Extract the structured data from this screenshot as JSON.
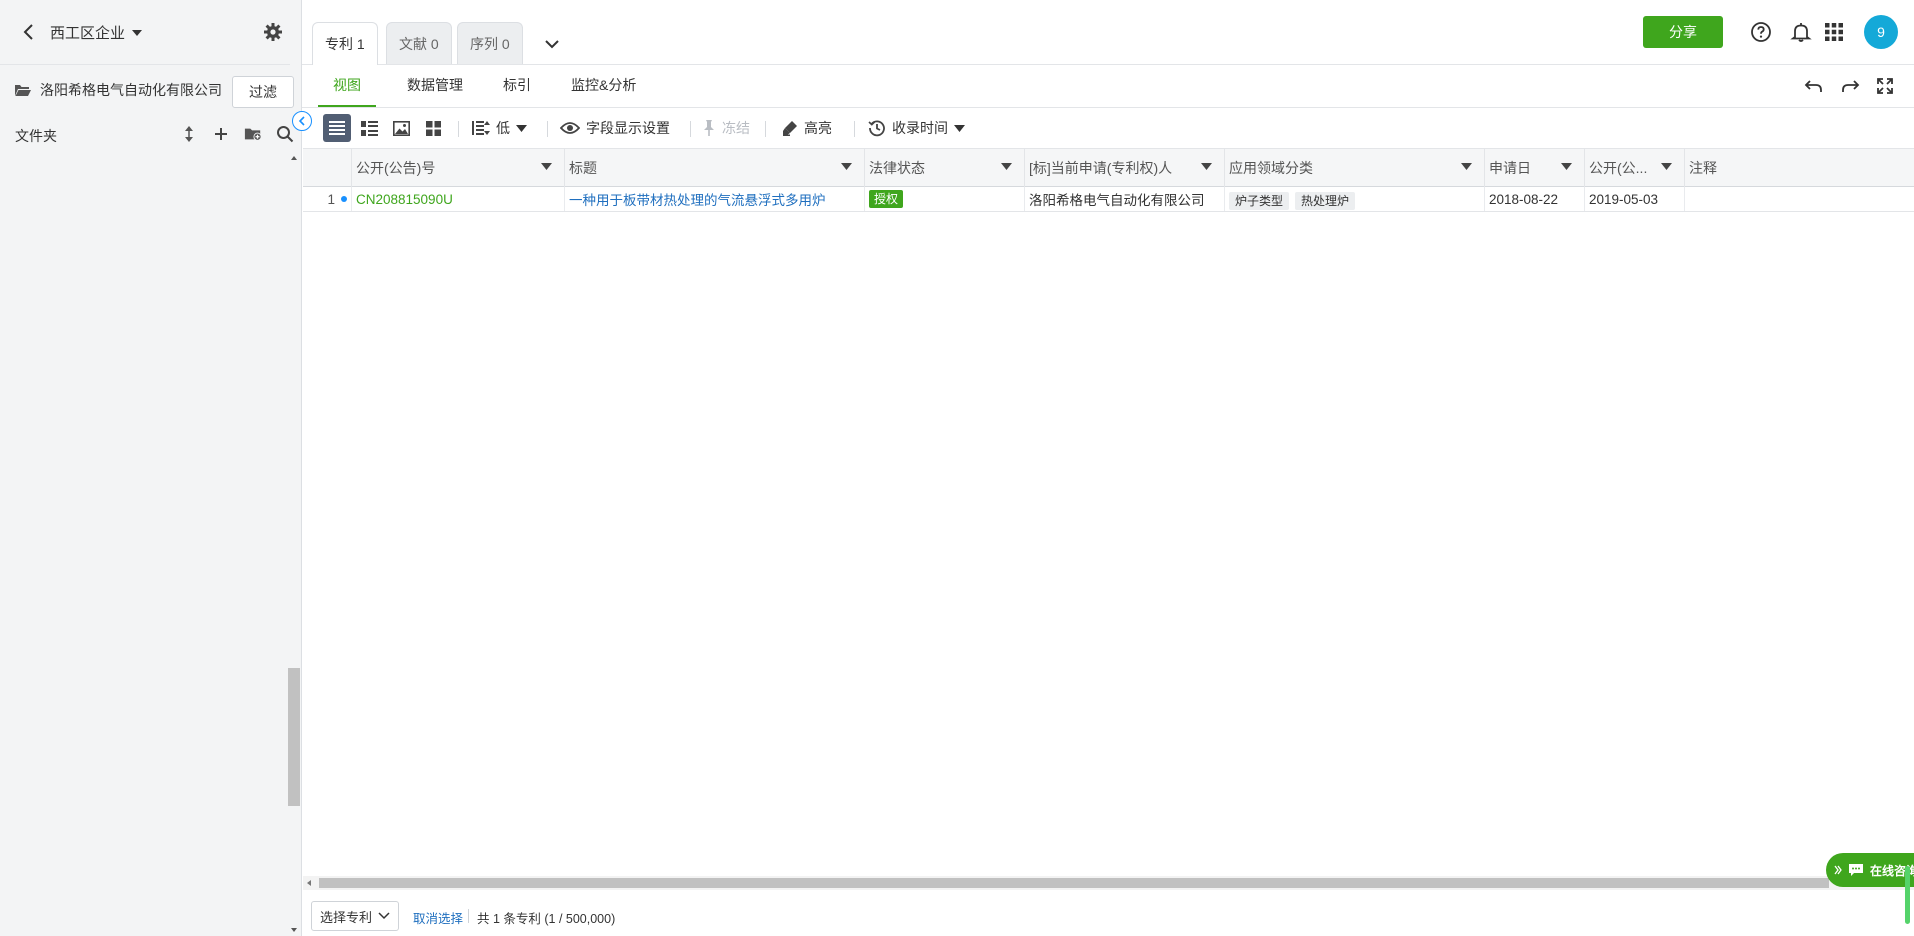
{
  "sidebar": {
    "workspace": "西工区企业",
    "company": "洛阳希格电气自动化有限公司",
    "filter_button": "过滤",
    "folder_label": "文件夹"
  },
  "doc_tabs": [
    {
      "label": "专利 1"
    },
    {
      "label": "文献 0"
    },
    {
      "label": "序列 0"
    }
  ],
  "header": {
    "share_button": "分享",
    "avatar_text": "9"
  },
  "subnav": [
    {
      "label": "视图"
    },
    {
      "label": "数据管理"
    },
    {
      "label": "标引"
    },
    {
      "label": "监控&分析"
    }
  ],
  "toolbar": {
    "density": "低",
    "field_display": "字段显示设置",
    "freeze": "冻结",
    "highlight": "高亮",
    "sort_by": "收录时间"
  },
  "table": {
    "columns": [
      "公开(公告)号",
      "标题",
      "法律状态",
      "[标]当前申请(专利权)人",
      "应用领域分类",
      "申请日",
      "公开(公...",
      "注释"
    ],
    "rows": [
      {
        "index": "1",
        "pub_no": "CN208815090U",
        "title": "一种用于板带材热处理的气流悬浮式多用炉",
        "legal_status": "授权",
        "applicant": "洛阳希格电气自动化有限公司",
        "tags": [
          "炉子类型",
          "热处理炉"
        ],
        "app_date": "2018-08-22",
        "pub_date": "2019-05-03",
        "note": ""
      }
    ]
  },
  "footer": {
    "select_label": "选择专利",
    "cancel_label": "取消选择",
    "count_text": "共 1 条专利 (1 / 500,000)"
  },
  "chat": {
    "label": "在线咨询"
  },
  "colors": {
    "accent": "#3fa61d",
    "link": "#1f6fbf",
    "avatar": "#14a9d8",
    "active_view": "#515e73"
  }
}
